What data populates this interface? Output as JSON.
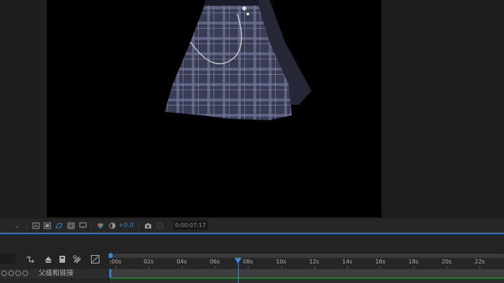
{
  "viewer": {
    "zoom_dropdown_label": "⌄",
    "exposure_value": "+0.0",
    "current_time": "0:00:07:17"
  },
  "timeline": {
    "layer_column_header": "父级和链接",
    "ruler_ticks": [
      ":00s",
      "02s",
      "04s",
      "06s",
      "08s",
      "10s",
      "12s",
      "14s",
      "16s",
      "18s",
      "20s",
      "22s"
    ]
  },
  "colors": {
    "accent": "#2b8ad8",
    "playhead": "#3a8de0",
    "track_green": "#1f7a3a"
  }
}
